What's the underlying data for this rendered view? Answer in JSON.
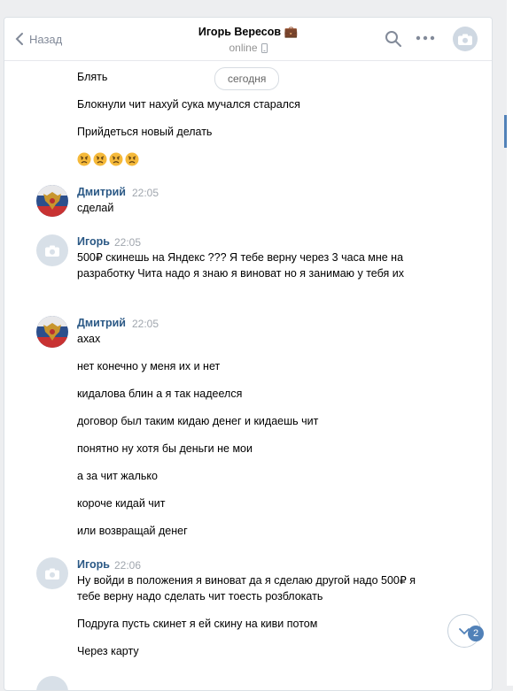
{
  "header": {
    "back_label": "Назад",
    "contact_name": "Игорь Вересов 💼",
    "status": "online"
  },
  "date_divider": "сегодня",
  "messages": [
    {
      "text": "Блять"
    },
    {
      "text": "Блокнули чит нахуй сука мучался старался"
    },
    {
      "text": "Прийдеться новый делать"
    },
    {
      "emoji_count": 4,
      "emoji": "angry-face"
    },
    {
      "author": "Дмитрий",
      "time": "22:05",
      "text": "сделай"
    },
    {
      "author": "Игорь",
      "time": "22:05",
      "text": "500₽ скинешь на Яндекс ??? Я тебе верну через 3 часа мне на разработку Чита надо я знаю я виноват но я занимаю у тебя их"
    },
    {
      "author": "Дмитрий",
      "time": "22:05",
      "text": "ахах"
    },
    {
      "text": "нет конечно у меня их и нет"
    },
    {
      "text": "кидалова блин а я так надеелся"
    },
    {
      "text": "договор был таким кидаю денег и кидаешь чит"
    },
    {
      "text": "понятно ну хотя бы деньги не мои"
    },
    {
      "text": "а за чит жалько"
    },
    {
      "text": "короче кидай чит"
    },
    {
      "text": "или возвращай денег"
    },
    {
      "author": "Игорь",
      "time": "22:06",
      "text": "Ну войди в положения я виноват да я сделаю другой надо 500₽ я тебе верну надо сделать чит тоесть розблокать"
    },
    {
      "text": "Подруга пусть скинет я ей скину на киви потом"
    },
    {
      "text": "Через карту"
    }
  ],
  "unread_badge": "2",
  "colors": {
    "accent": "#5181b8",
    "author": "#2a5885",
    "background": "#edeef0"
  }
}
